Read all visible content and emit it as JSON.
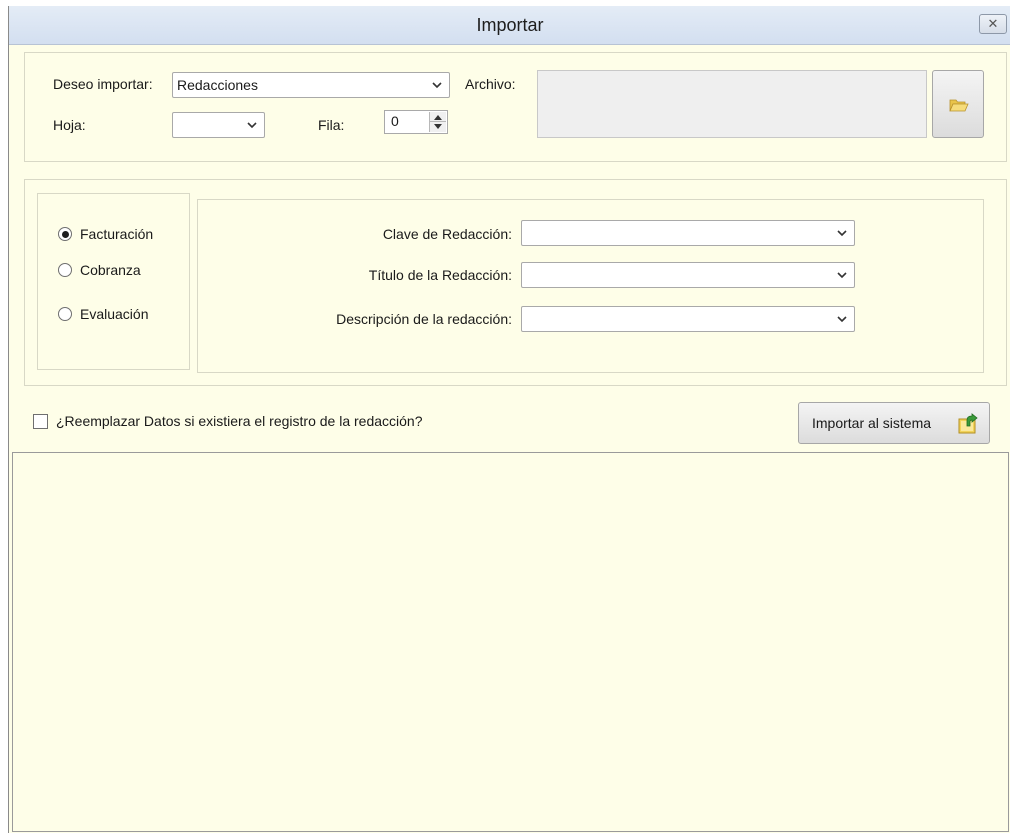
{
  "window": {
    "title": "Importar",
    "close_icon": "close-icon"
  },
  "top": {
    "deseo_importar_label": "Deseo importar:",
    "deseo_importar_value": "Redacciones",
    "archivo_label": "Archivo:",
    "hoja_label": "Hoja:",
    "hoja_value": "",
    "fila_label": "Fila:",
    "fila_value": "0",
    "browse_icon": "folder-open-icon"
  },
  "options": {
    "radios": [
      {
        "label": "Facturación",
        "checked": true
      },
      {
        "label": "Cobranza",
        "checked": false
      },
      {
        "label": "Evaluación",
        "checked": false
      }
    ]
  },
  "mapping": {
    "fields": [
      {
        "label": "Clave de Redacción:",
        "value": ""
      },
      {
        "label": "Título de la Redacción:",
        "value": ""
      },
      {
        "label": "Descripción de la redacción:",
        "value": ""
      }
    ]
  },
  "replace": {
    "label": "¿Reemplazar Datos si existiera el registro de la redacción?",
    "checked": false
  },
  "import_button": {
    "label": "Importar al sistema",
    "icon": "import-icon"
  },
  "colors": {
    "background": "#fefee8",
    "titlebar": "#d3dff0",
    "icon_yellow": "#f2d35a",
    "icon_green": "#3a9a3a"
  }
}
